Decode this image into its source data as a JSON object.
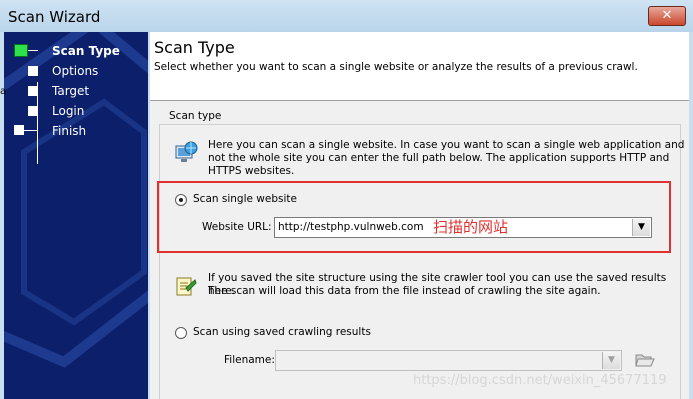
{
  "window": {
    "title": "Scan Wizard",
    "close_glyph": "✕"
  },
  "sidebar": {
    "steps": [
      {
        "label": "Scan Type",
        "current": true
      },
      {
        "label": "Options",
        "current": false
      },
      {
        "label": "Target",
        "current": false
      },
      {
        "label": "Login",
        "current": false
      },
      {
        "label": "Finish",
        "current": false
      }
    ]
  },
  "header": {
    "title": "Scan Type",
    "subtitle": "Select whether you want to scan a single website or analyze the results of a previous crawl."
  },
  "group": {
    "label": "Scan type",
    "single_info_line1": "Here you can scan a single website. In case you want to scan a single web application and",
    "single_info_line2": "not the whole site you can enter the full path below. The application supports HTTP and",
    "single_info_line3": "HTTPS websites.",
    "single_radio_label": "Scan single website",
    "single_radio_checked": true,
    "url_label": "Website URL:",
    "url_value": "http://testphp.vulnweb.com",
    "saved_info_line1": "If you saved the site structure using the site crawler tool you can use the saved results here.",
    "saved_info_line2": "The scan will load this data from the file instead of crawling the site again.",
    "saved_radio_label": "Scan using saved crawling results",
    "saved_radio_checked": false,
    "filename_label": "Filename:",
    "filename_value": ""
  },
  "annotation": {
    "text": "扫描的网站",
    "color": "#e0312e"
  },
  "watermark": "https://blog.csdn.net/weixin_45677119",
  "edge_fragment": "a",
  "icons": {
    "current_step": "green-square-icon",
    "pending_step": "white-square-icon",
    "web_info": "globe-computer-icon",
    "crawl_info": "crawl-data-icon",
    "folder": "folder-open-icon",
    "dropdown": "chevron-down-icon"
  },
  "colors": {
    "sidebar_bg": "#0b1f6b",
    "current_step": "#2ee04a",
    "annotation": "#e0312e"
  }
}
